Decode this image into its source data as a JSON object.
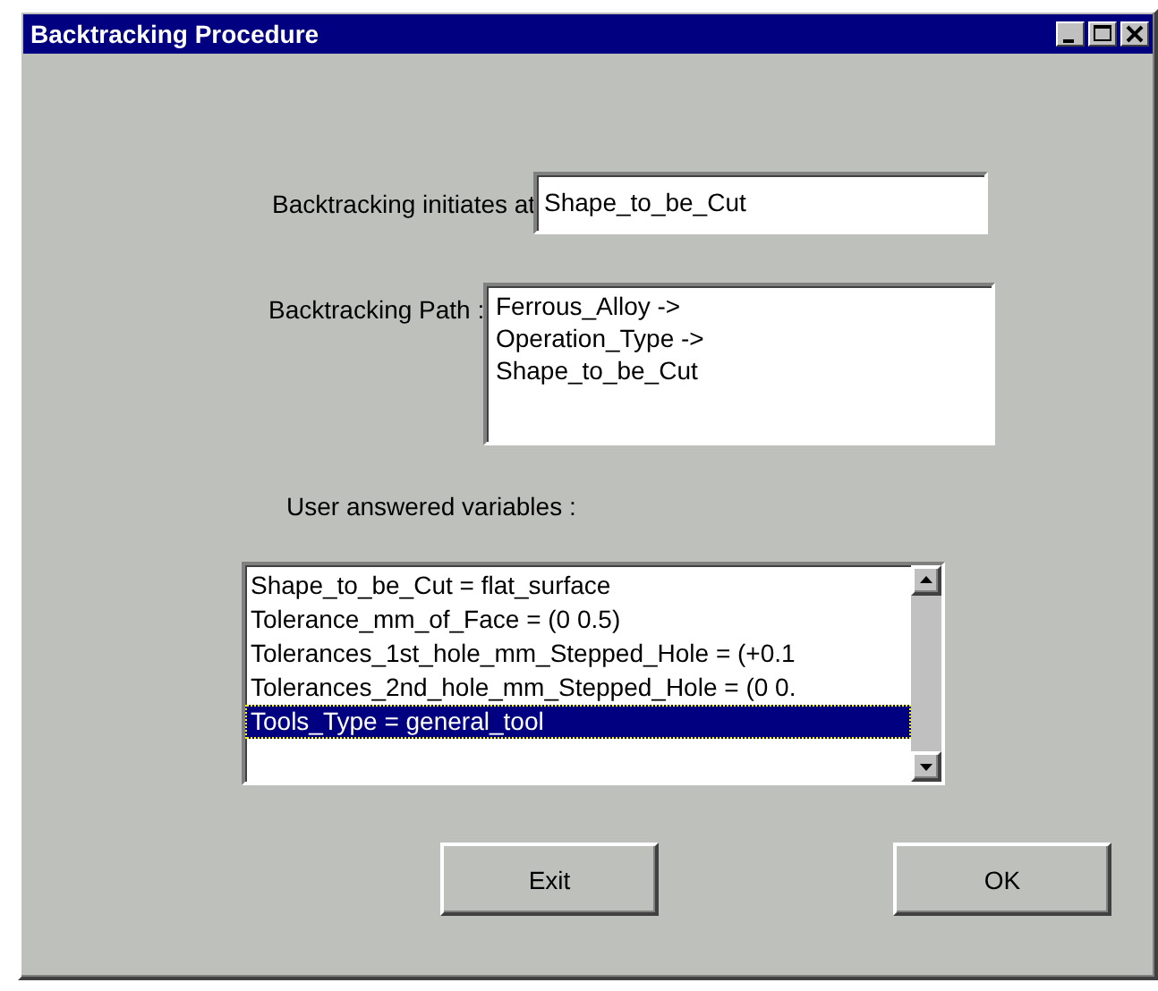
{
  "window": {
    "title": "Backtracking Procedure"
  },
  "initiates": {
    "label": "Backtracking initiates at",
    "value": "Shape_to_be_Cut"
  },
  "path": {
    "label": "Backtracking Path :",
    "lines": [
      "Ferrous_Alloy ->",
      "Operation_Type ->",
      "Shape_to_be_Cut"
    ]
  },
  "variables": {
    "label": "User answered variables :",
    "items": [
      {
        "text": "Shape_to_be_Cut = flat_surface",
        "selected": false
      },
      {
        "text": "Tolerance_mm_of_Face = (0 0.5)",
        "selected": false
      },
      {
        "text": "Tolerances_1st_hole_mm_Stepped_Hole = (+0.1",
        "selected": false
      },
      {
        "text": "Tolerances_2nd_hole_mm_Stepped_Hole = (0 0.",
        "selected": false
      },
      {
        "text": "Tools_Type = general_tool",
        "selected": true
      }
    ]
  },
  "buttons": [
    "Exit",
    "OK"
  ]
}
